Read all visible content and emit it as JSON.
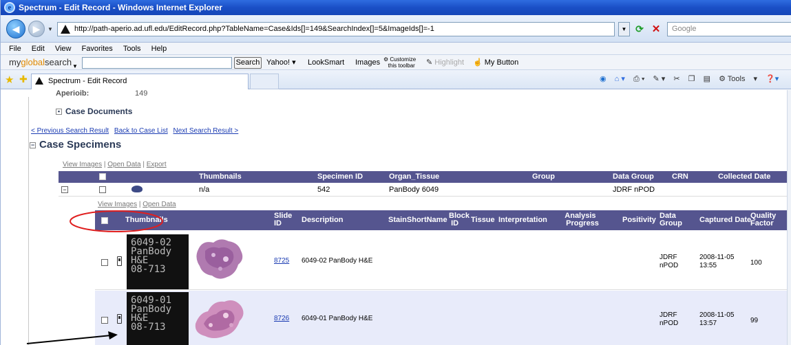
{
  "window": {
    "title": "Spectrum - Edit Record - Windows Internet Explorer"
  },
  "address": {
    "url": "http://path-aperio.ad.ufl.edu/EditRecord.php?TableName=Case&Ids[]=149&SearchIndex[]=5&ImageIds[]=-1",
    "search_placeholder": "Google"
  },
  "menu": [
    "File",
    "Edit",
    "View",
    "Favorites",
    "Tools",
    "Help"
  ],
  "toolbar": {
    "logo_pre": "my",
    "logo_mid": "global",
    "logo_post": "search",
    "search_label": "Search",
    "items": [
      "Yahoo!",
      "LookSmart",
      "Images"
    ],
    "customize_line1": "Customize",
    "customize_line2": "this toolbar",
    "highlight": "Highlight",
    "my_button": "My Button"
  },
  "tab": {
    "title": "Spectrum - Edit Record"
  },
  "command_bar": {
    "tools": "Tools"
  },
  "page": {
    "aperio_label": "Aperioib:",
    "aperio_value": "149",
    "case_documents": "Case Documents",
    "nav_prev": "< Previous Search Result",
    "nav_back": "Back to Case List",
    "nav_next": "Next Search Result >",
    "case_specimens": "Case Specimens",
    "spec_links": {
      "view_images": "View Images",
      "open_data": "Open Data",
      "export": "Export"
    },
    "spec_columns": [
      "Thumbnails",
      "Specimen ID",
      "Organ_Tissue",
      "Group",
      "Data Group",
      "CRN",
      "Collected Date"
    ],
    "specimen": {
      "thumbnail": "n/a",
      "id": "542",
      "organ": "PanBody 6049",
      "data_group": "JDRF nPOD"
    },
    "sub_links": {
      "view_images": "View Images",
      "open_data": "Open Data"
    },
    "slide_columns": {
      "thumbnails": "Thumbnails",
      "slide_id_1": "Slide",
      "slide_id_2": "ID",
      "description": "Description",
      "stain": "StainShortName",
      "block_1": "Block",
      "block_2": "ID",
      "tissue": "Tissue",
      "interpretation": "Interpretation",
      "analysis_1": "Analysis",
      "analysis_2": "Progress",
      "positivity": "Positivity",
      "dgroup_1": "Data",
      "dgroup_2": "Group",
      "captured": "Captured Date",
      "quality_1": "Quality",
      "quality_2": "Factor"
    },
    "slides": [
      {
        "label": [
          "6049-02",
          "PanBody",
          "H&E",
          "08-713"
        ],
        "id": "8725",
        "description": "6049-02 PanBody H&E",
        "dg1": "JDRF",
        "dg2": "nPOD",
        "date": "2008-11-05",
        "time": "13:55",
        "quality": "100"
      },
      {
        "label": [
          "6049-01",
          "PanBody",
          "H&E",
          "08-713"
        ],
        "id": "8726",
        "description": "6049-01 PanBody H&E",
        "dg1": "JDRF",
        "dg2": "nPOD",
        "date": "2008-11-05",
        "time": "13:57",
        "quality": "99"
      }
    ]
  },
  "colors": {
    "header_bg": "#55558f",
    "link": "#1a3bb2",
    "annotation": "#e02020",
    "row_alt": "#e8ebfa"
  }
}
